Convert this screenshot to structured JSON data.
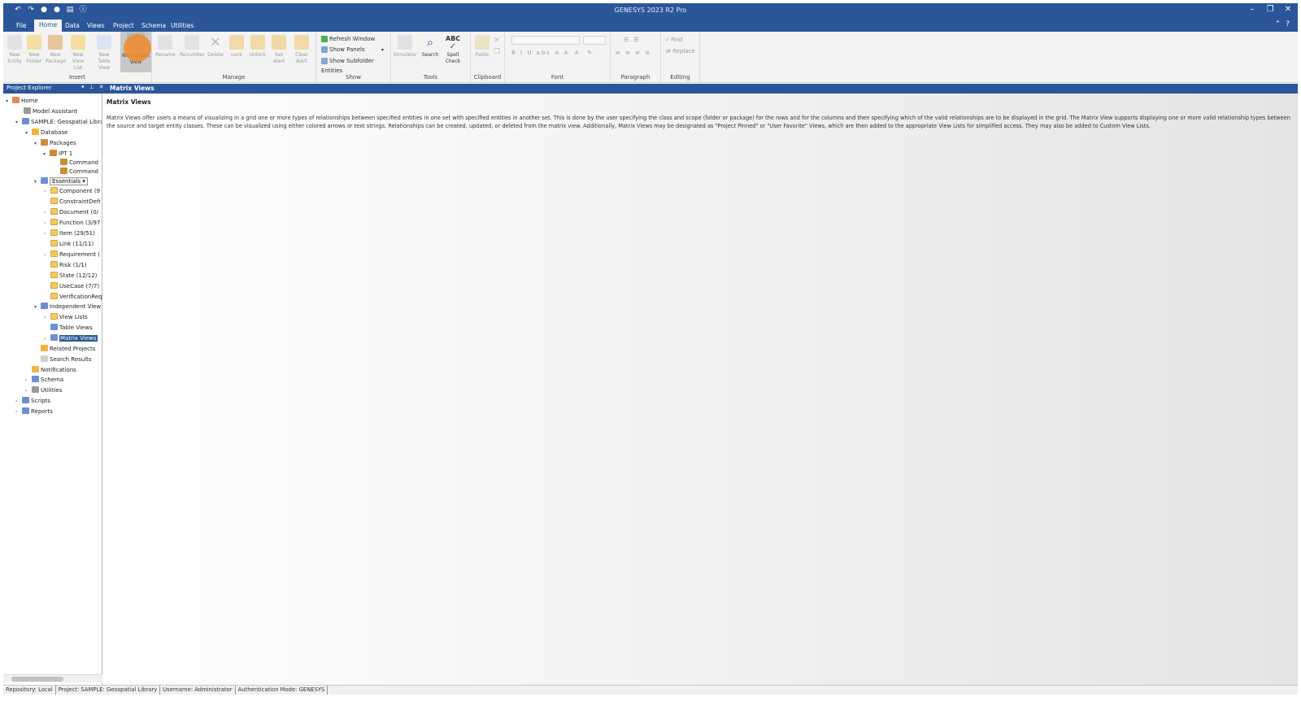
{
  "window": {
    "title": "GENESYS 2023 R2 Pro"
  },
  "menu": {
    "tabs": [
      "File",
      "Home",
      "Data",
      "Views",
      "Project",
      "Schema",
      "Utilities"
    ],
    "active": "Home"
  },
  "ribbon": {
    "insert": {
      "label": "Insert",
      "buttons": [
        "New Entity",
        "New Folder",
        "New Package",
        "New View List",
        "New Table View",
        "New Matrix View"
      ]
    },
    "manage": {
      "label": "Manage",
      "buttons": [
        "Rename",
        "Renumber",
        "Delete",
        "Lock",
        "Unlock",
        "Set Alert",
        "Clear Alert"
      ]
    },
    "show": {
      "label": "Show",
      "refresh": "Refresh Window",
      "panels": "Show Panels",
      "subfolder": "Show Subfolder Entities"
    },
    "tools": {
      "label": "Tools",
      "buttons": [
        "Simulator",
        "Search",
        "Spell Check"
      ]
    },
    "clipboard": {
      "label": "Clipboard",
      "paste": "Paste"
    },
    "font": {
      "label": "Font"
    },
    "paragraph": {
      "label": "Paragraph"
    },
    "editing": {
      "label": "Editing",
      "find": "Find",
      "replace": "Replace"
    }
  },
  "explorer": {
    "title": "Project Explorer",
    "items": [
      "Home",
      "Model Assistant",
      "SAMPLE: Geospatial Libra",
      "Database",
      "Packages",
      "IPT 1",
      "Command",
      "Command",
      "Essentials",
      "Component (9",
      "ConstraintDefi",
      "Document (0/",
      "Function (3/97",
      "Item (29/51)",
      "Link (11/11)",
      "Requirement (",
      "Risk (1/1)",
      "State (12/12)",
      "UseCase (7/7)",
      "VerificationReq",
      "Independent View",
      "View Lists",
      "Table Views",
      "Matrix Views",
      "Related Projects",
      "Search Results",
      "Notifications",
      "Schema",
      "Utilities",
      "Scripts",
      "Reports"
    ]
  },
  "main": {
    "panel_title": "Matrix Views",
    "heading": "Matrix Views",
    "description": "Matrix Views offer users a means of visualizing in a grid one or more types of relationships between specified entities in one set with specified entities in another set. This is done by the user specifying the class and scope (folder or package) for the rows and for the columns and then specifying which of the valid relationships are to be displayed in the grid. The Matrix View supports displaying one or more valid relationship types between the source and target entity classes. These can be visualized using either colored arrows or text strings. Relationships can be created, updated, or deleted from the matrix view. Additionally, Matrix Views may be designated as \"Project Pinned\" or \"User Favorite\" Views, which are then added to the appropriate View Lists for simplified access. They may also be added to Custom View Lists."
  },
  "status": {
    "repository": "Repository: Local",
    "project": "Project: SAMPLE: Geospatial Library",
    "username": "Username: Administrator",
    "auth": "Authentication Mode: GENESYS"
  },
  "colors": {
    "accent": "#2b579a",
    "highlight": "#f08a2a"
  }
}
